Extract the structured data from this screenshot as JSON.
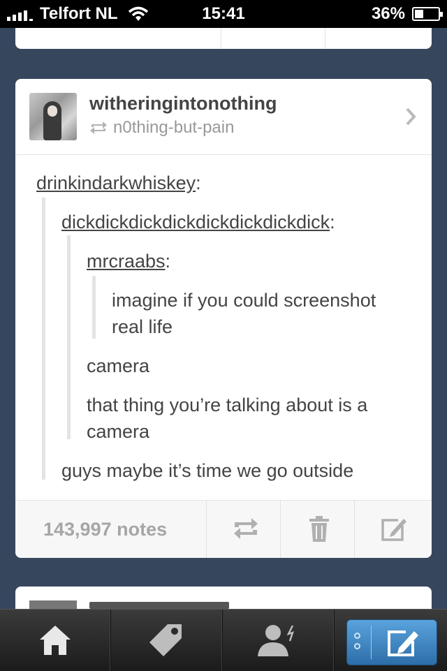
{
  "status_bar": {
    "carrier": "Telfort NL",
    "time": "15:41",
    "battery": "36%",
    "battery_level": 0.36
  },
  "post": {
    "username": "witheringintonothing",
    "reblogged_from": "n0thing-but-pain",
    "thread": {
      "user1": "drinkindarkwhiskey",
      "user2": "dickdickdickdickdickdickdickdick",
      "user3": "mrcraabs",
      "quote_line1": "imagine if you could screenshot",
      "quote_line2": "real life",
      "reply1": "camera",
      "reply2_line1": "that thing you’re talking about is a",
      "reply2_line2": "camera",
      "reply3": "guys maybe it’s time we go outside"
    },
    "notes": "143,997 notes",
    "colon": ":"
  },
  "tab_bar": {
    "tabs": [
      "home-icon",
      "tag-icon",
      "account-icon",
      "compose-icon"
    ]
  },
  "colors": {
    "background": "#36465d",
    "compose_accent": "#3f86c6"
  }
}
